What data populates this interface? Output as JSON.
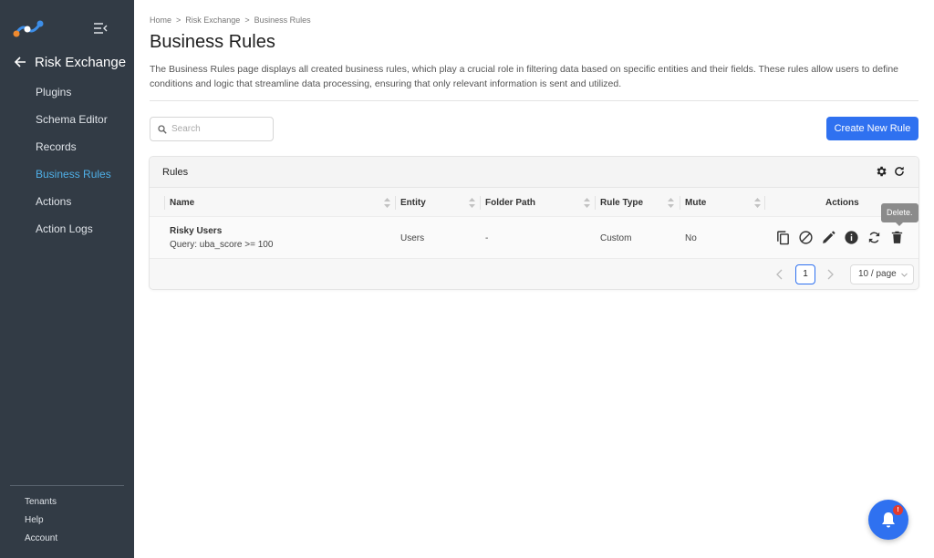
{
  "sidebar": {
    "module_title": "Risk Exchange",
    "items": [
      {
        "label": "Plugins",
        "active": false
      },
      {
        "label": "Schema Editor",
        "active": false
      },
      {
        "label": "Records",
        "active": false
      },
      {
        "label": "Business Rules",
        "active": true
      },
      {
        "label": "Actions",
        "active": false
      },
      {
        "label": "Action Logs",
        "active": false
      }
    ],
    "bottom_items": [
      "Tenants",
      "Help",
      "Account"
    ],
    "active_color": "#4fb0e8",
    "background": "#323b45"
  },
  "breadcrumb": [
    "Home",
    "Risk Exchange",
    "Business Rules"
  ],
  "breadcrumb_separator": ">",
  "page": {
    "title": "Business Rules",
    "description": "The Business Rules page displays all created business rules, which play a crucial role in filtering data based on specific entities and their fields. These rules allow users to define conditions and logic that streamline data processing, ensuring that only relevant information is sent and utilized."
  },
  "search": {
    "placeholder": "Search",
    "value": ""
  },
  "create_button": "Create New Rule",
  "accent_color": "#2f71f0",
  "table": {
    "title": "Rules",
    "columns": [
      "Name",
      "Entity",
      "Folder Path",
      "Rule Type",
      "Mute",
      "Actions"
    ],
    "rows": [
      {
        "name": "Risky Users",
        "query": "Query: uba_score >= 100",
        "entity": "Users",
        "folder_path": "-",
        "rule_type": "Custom",
        "mute": "No",
        "actions": [
          "copy-icon",
          "disable-icon",
          "edit-icon",
          "info-icon",
          "sync-icon",
          "delete-icon"
        ]
      }
    ],
    "tooltip": "Delete.",
    "pagination": {
      "current_page": "1",
      "page_size": "10 / page"
    }
  },
  "notifications": {
    "badge": "!"
  }
}
